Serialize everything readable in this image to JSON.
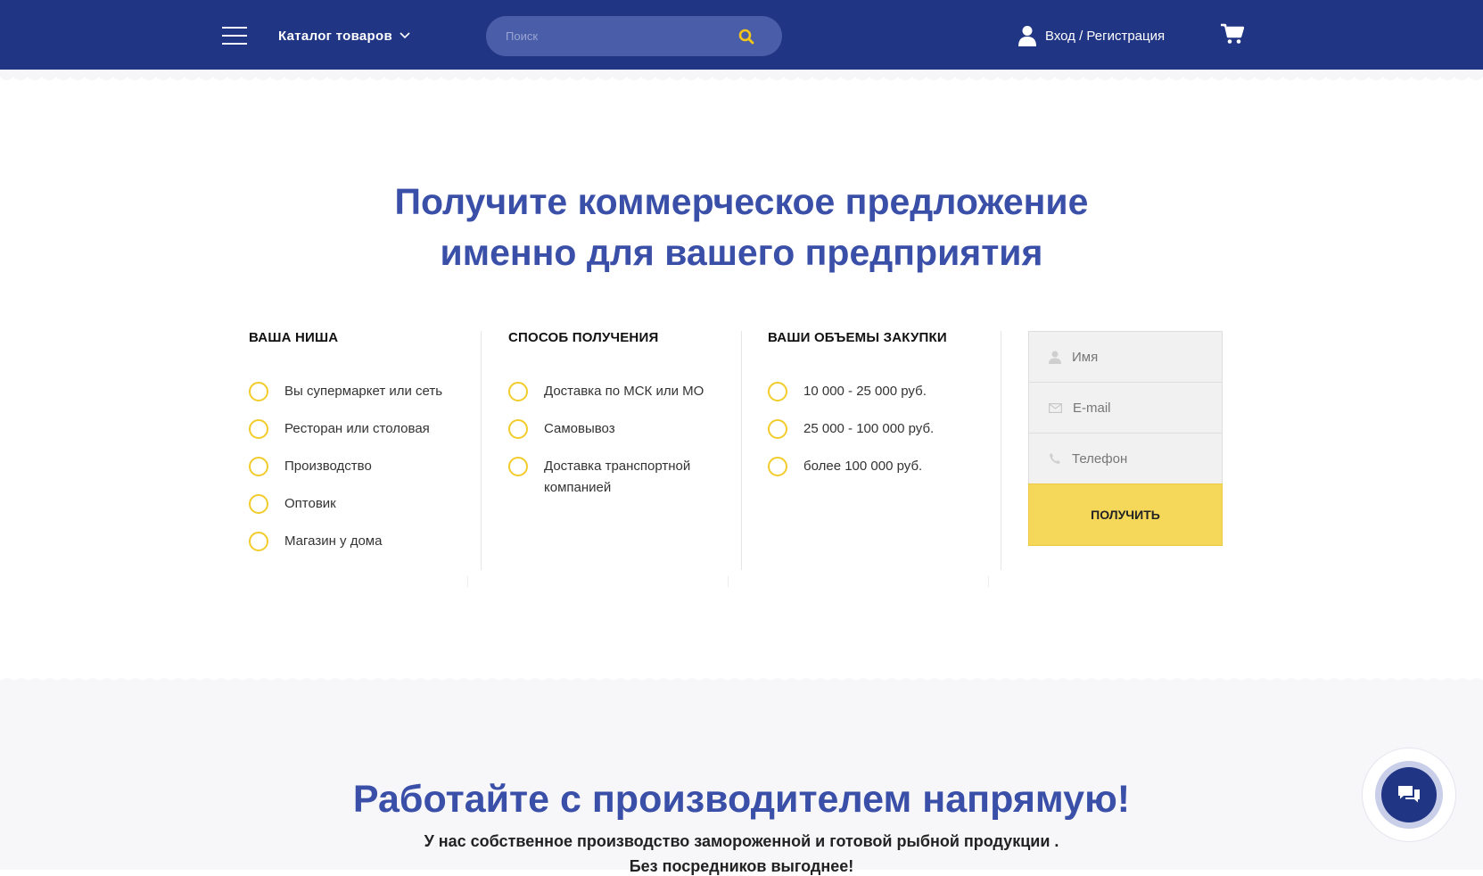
{
  "header": {
    "catalog_label": "Каталог товаров",
    "search_placeholder": "Поиск",
    "login_label": "Вход / Регистрация",
    "bg_color": "#203584",
    "accent_color": "#f5c518"
  },
  "offer": {
    "title_line1": "Получите коммерческое предложение",
    "title_line2": "именно для вашего предприятия",
    "columns": [
      {
        "heading": "ВАША НИША",
        "options": [
          "Вы супермаркет или сеть",
          "Ресторан или столовая",
          "Производство",
          "Оптовик",
          "Магазин у дома"
        ]
      },
      {
        "heading": "СПОСОБ ПОЛУЧЕНИЯ",
        "options": [
          "Доставка по МСК или МО",
          "Самовывоз",
          "Доставка транспортной компанией"
        ]
      },
      {
        "heading": "ВАШИ ОБЪЕМЫ ЗАКУПКИ",
        "options": [
          "10 000 - 25 000 руб.",
          "25 000 - 100 000 руб.",
          "более 100 000 руб."
        ]
      }
    ],
    "form": {
      "name_placeholder": "Имя",
      "email_placeholder": "E-mail",
      "phone_placeholder": "Телефон",
      "submit_label": "ПОЛУЧИТЬ"
    }
  },
  "manufacturer": {
    "title": "Работайте с производителем напрямую!",
    "subtitle": "У нас собственное производство замороженной и готовой рыбной продукции .",
    "subtitle2": "Без посредников выгоднее!"
  },
  "icons": {
    "menu": "hamburger-icon",
    "search": "search-icon",
    "user": "user-icon",
    "cart": "cart-icon",
    "chat": "chat-icon"
  }
}
